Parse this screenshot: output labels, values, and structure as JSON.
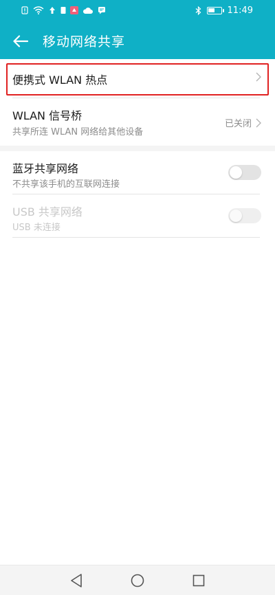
{
  "status_bar": {
    "time": "11:49",
    "battery_level": 0.55
  },
  "app_bar": {
    "title": "移动网络共享"
  },
  "settings": {
    "portable_hotspot": {
      "title": "便携式 WLAN 热点"
    },
    "wlan_bridge": {
      "title": "WLAN 信号桥",
      "subtitle": "共享所连 WLAN 网络给其他设备",
      "status": "已关闭"
    },
    "bluetooth_tethering": {
      "title": "蓝牙共享网络",
      "subtitle": "不共享该手机的互联网连接",
      "enabled": false
    },
    "usb_tethering": {
      "title": "USB 共享网络",
      "subtitle": "USB 未连接",
      "enabled": false,
      "disabled": true
    }
  },
  "colors": {
    "header": "#0fb0c6",
    "highlight": "#e02020"
  },
  "icons": {
    "back": "back-arrow-icon",
    "chevron": "chevron-right-icon",
    "nav_back": "triangle-back-icon",
    "nav_home": "circle-home-icon",
    "nav_recent": "square-recent-icon"
  }
}
